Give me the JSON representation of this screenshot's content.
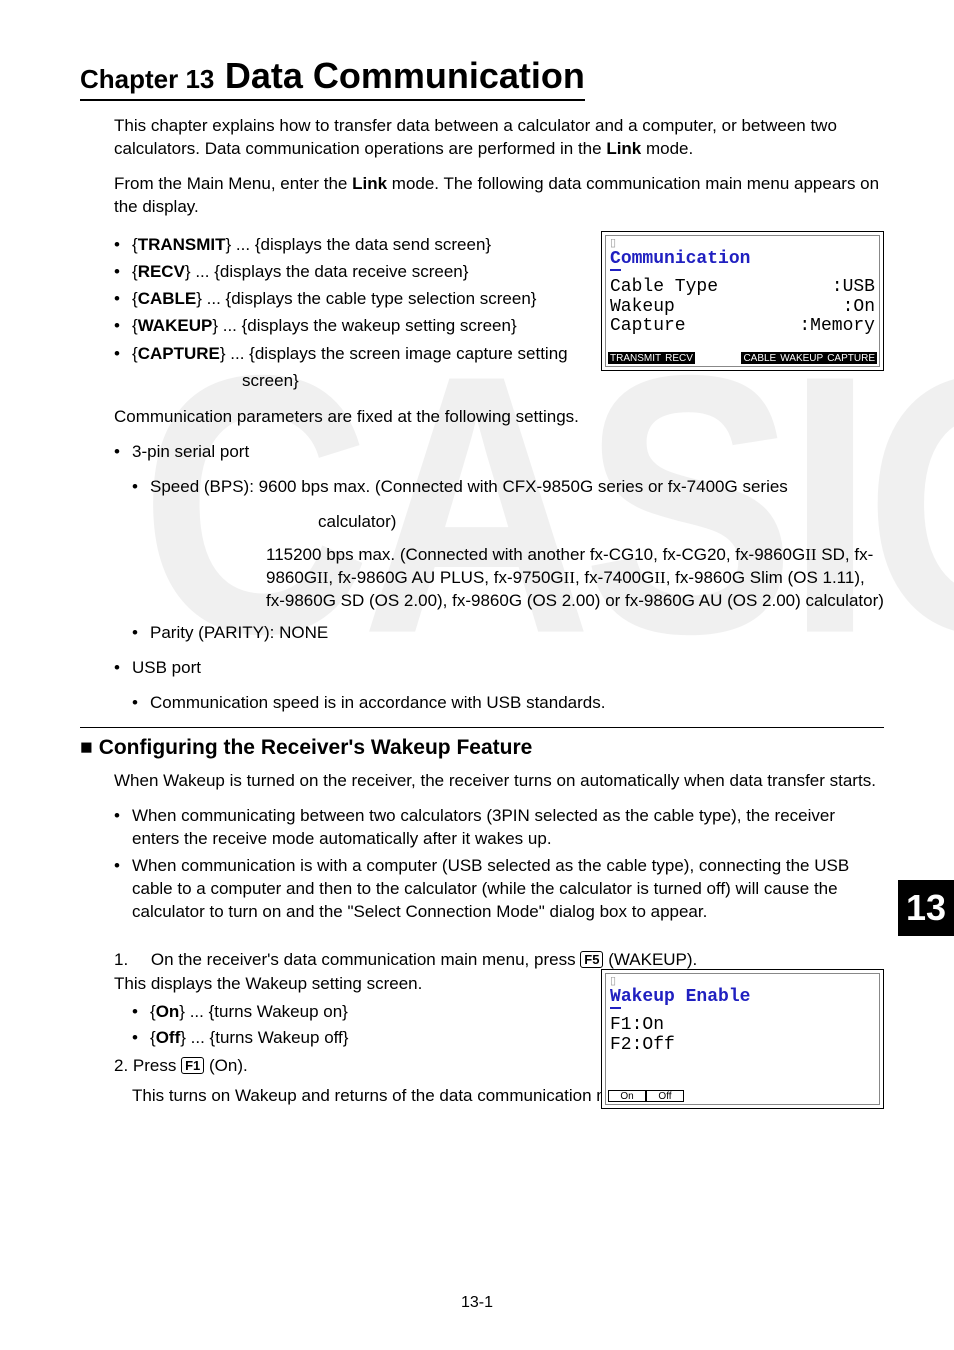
{
  "chapter": {
    "label": "Chapter 13",
    "title": "Data Communication",
    "tab": "13"
  },
  "intro": {
    "p1_a": "This chapter explains how to transfer data between a calculator and a computer, or between two calculators. Data communication operations are performed in the ",
    "p1_bold": "Link",
    "p1_b": " mode.",
    "p2_a": "From the Main Menu, enter the ",
    "p2_bold": "Link",
    "p2_b": " mode. The following data communication main menu appears on the display."
  },
  "menu": {
    "transmit_k": "TRANSMIT",
    "transmit_d": " ... {displays the data send screen}",
    "recv_k": "RECV",
    "recv_d": " ... {displays the data receive screen}",
    "cable_k": "CABLE",
    "cable_d": " ... {displays the cable type selection screen}",
    "wakeup_k": "WAKEUP",
    "wakeup_d": " ... {displays the wakeup setting screen}",
    "capture_k": "CAPTURE",
    "capture_d_a": " ... {displays the screen image capture setting",
    "capture_d_b": "screen}"
  },
  "params": {
    "lead": "Communication parameters are fixed at the following settings.",
    "serial": "3-pin serial port",
    "speed1": "Speed (BPS): 9600 bps max. (Connected with CFX-9850G series or fx-7400G series calculator)",
    "speed1_cont": "calculator)",
    "speed1_line": "Speed (BPS): 9600 bps max. (Connected with CFX-9850G series or fx-7400G series",
    "speed2_a": "115200 bps max. (Connected with another fx-CG10, fx-CG20, fx-9860G",
    "speed2_b": " SD, fx-9860G",
    "speed2_c": ", fx-9860G AU PLUS, fx-9750G",
    "speed2_d": ", fx-7400G",
    "speed2_e": ", fx-9860G Slim (OS 1.11), fx-9860G SD (OS 2.00), fx-9860G (OS 2.00) or fx-9860G AU (OS 2.00) calculator)",
    "ii": "II",
    "parity": "Parity (PARITY): NONE",
    "usb": "USB port",
    "usb_speed": "Communication speed is in accordance with USB standards."
  },
  "section": {
    "title": "Configuring the Receiver's Wakeup Feature"
  },
  "wakeup": {
    "p1": "When Wakeup is turned on the receiver, the receiver turns on automatically when data transfer starts.",
    "b1": "When communicating between two calculators (3PIN selected as the cable type), the receiver enters the receive mode automatically after it wakes up.",
    "b2": "When communication is with a computer (USB selected as the cable type), connecting the USB cable to a computer and then to the calculator (while the calculator is turned off) will cause the calculator to turn on and the \"Select Connection Mode\" dialog box to appear.",
    "step1_a": "On the receiver's data communication main menu, press ",
    "step1_key": "F5",
    "step1_b": " (WAKEUP).",
    "step1_c": "This displays the Wakeup setting screen.",
    "on_k": "On",
    "on_d": " ... {turns Wakeup on}",
    "off_k": "Off",
    "off_d": " ... {turns Wakeup off}",
    "step2_a": "Press ",
    "step2_key": "F1",
    "step2_b": " (On).",
    "step2_c": "This turns on Wakeup and returns of the data communication main menu."
  },
  "screen1": {
    "title_first": "C",
    "title_rest": "ommunication",
    "r1k": "Cable Type",
    "r1v": ":USB",
    "r2k": "Wakeup",
    "r2v": ":On",
    "r3k": "Capture",
    "r3v": ":Memory",
    "f1": "TRANSMIT",
    "f2": "RECV",
    "f4": "CABLE",
    "f5": "WAKEUP",
    "f6": "CAPTURE"
  },
  "screen2": {
    "title_first": "W",
    "title_rest": "akeup Enable",
    "l1": "F1:On",
    "l2": "F2:Off",
    "f1": "On",
    "f2": "Off"
  },
  "pagenum": "13-1"
}
